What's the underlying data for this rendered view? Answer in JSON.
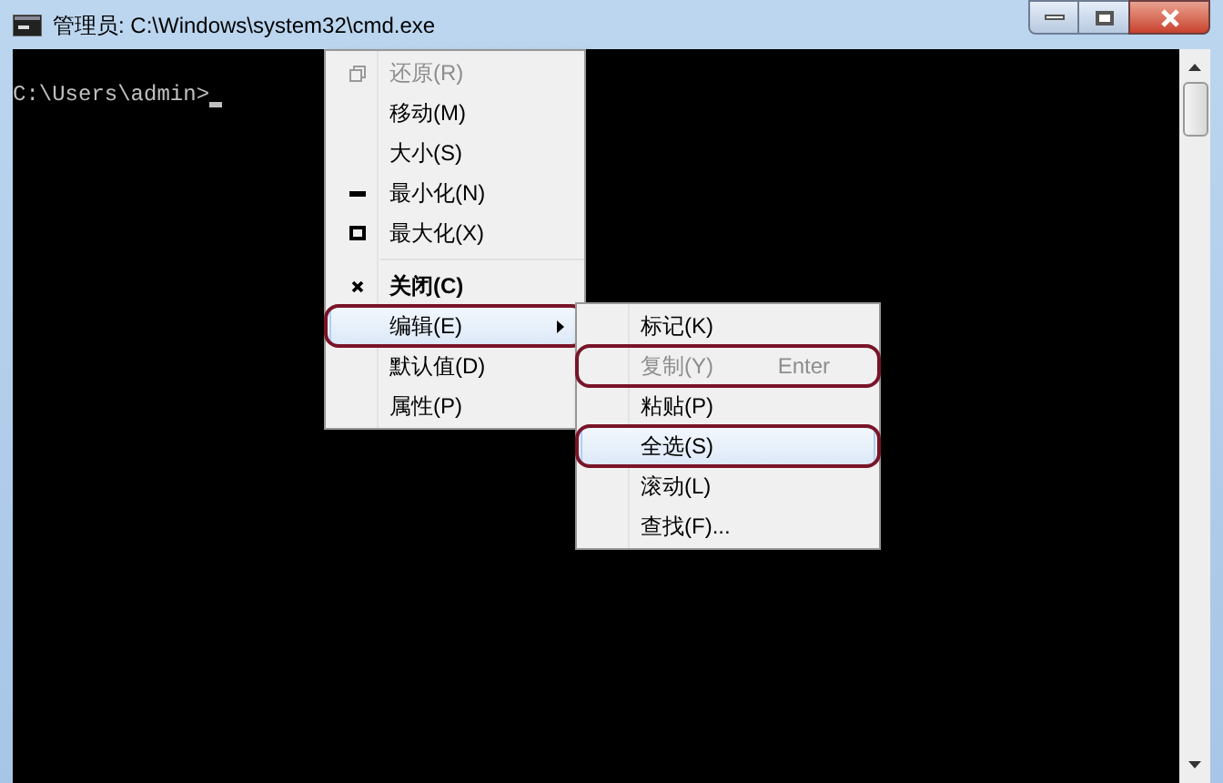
{
  "window": {
    "title": "管理员: C:\\Windows\\system32\\cmd.exe"
  },
  "console": {
    "prompt": "C:\\Users\\admin>"
  },
  "system_menu": {
    "items": [
      {
        "label": "还原(R)",
        "kind": "restore",
        "disabled": true,
        "bold": false,
        "selected": false,
        "circled": false,
        "submenu": false
      },
      {
        "label": "移动(M)",
        "disabled": false,
        "bold": false,
        "selected": false,
        "circled": false,
        "submenu": false
      },
      {
        "label": "大小(S)",
        "disabled": false,
        "bold": false,
        "selected": false,
        "circled": false,
        "submenu": false
      },
      {
        "label": "最小化(N)",
        "kind": "minimize",
        "disabled": false,
        "bold": false,
        "selected": false,
        "circled": false,
        "submenu": false
      },
      {
        "label": "最大化(X)",
        "kind": "maximize",
        "disabled": false,
        "bold": false,
        "selected": false,
        "circled": false,
        "submenu": false
      },
      {
        "kind": "separator"
      },
      {
        "label": "关闭(C)",
        "kind": "close",
        "disabled": false,
        "bold": true,
        "selected": false,
        "circled": false,
        "submenu": false
      },
      {
        "label": "编辑(E)",
        "disabled": false,
        "bold": false,
        "selected": true,
        "circled": true,
        "submenu": true
      },
      {
        "label": "默认值(D)",
        "disabled": false,
        "bold": false,
        "selected": false,
        "circled": false,
        "submenu": false
      },
      {
        "label": "属性(P)",
        "disabled": false,
        "bold": false,
        "selected": false,
        "circled": false,
        "submenu": false
      }
    ]
  },
  "edit_submenu": {
    "items": [
      {
        "label": "标记(K)",
        "disabled": false,
        "selected": false,
        "circled": false
      },
      {
        "label": "复制(Y)",
        "shortcut": "Enter",
        "disabled": true,
        "selected": false,
        "circled": true
      },
      {
        "label": "粘贴(P)",
        "disabled": false,
        "selected": false,
        "circled": false
      },
      {
        "label": "全选(S)",
        "disabled": false,
        "selected": true,
        "circled": true
      },
      {
        "label": "滚动(L)",
        "disabled": false,
        "selected": false,
        "circled": false
      },
      {
        "label": "查找(F)...",
        "disabled": false,
        "selected": false,
        "circled": false
      }
    ]
  }
}
